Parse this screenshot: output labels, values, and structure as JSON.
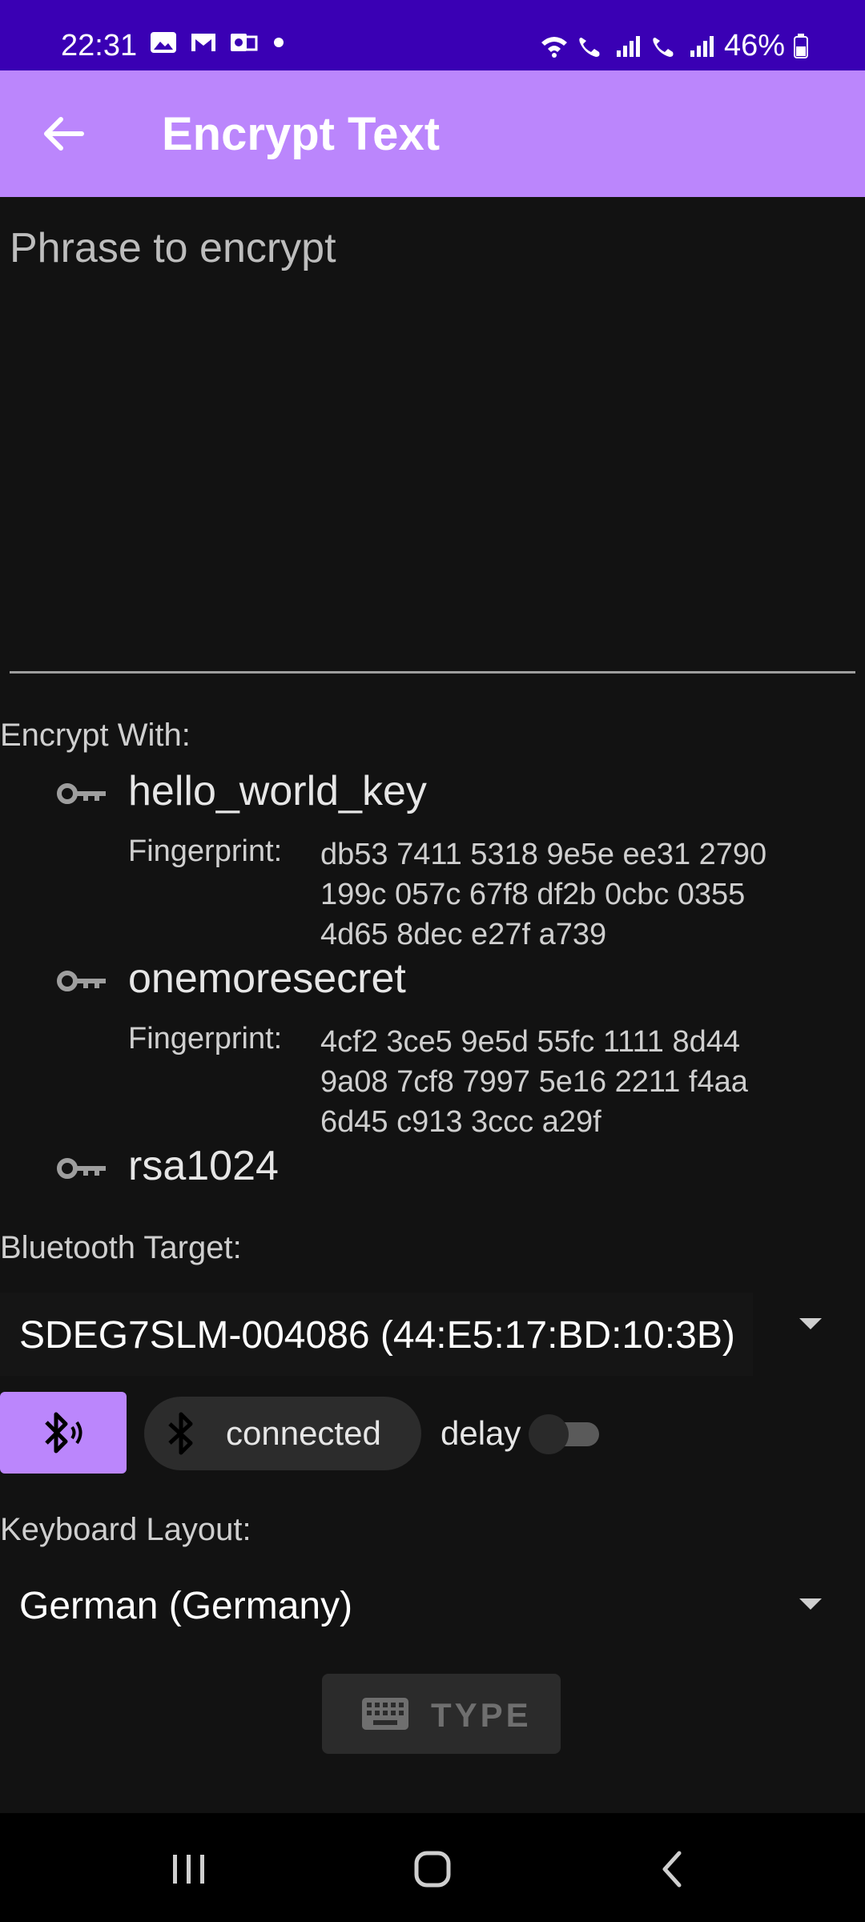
{
  "status_bar": {
    "time": "22:31",
    "battery": "46%",
    "left_icons": [
      "gallery-icon",
      "gmail-icon",
      "outlook-icon",
      "dot"
    ],
    "right_icons": [
      "wifi-icon",
      "wifi-call-1-icon",
      "signal-1-icon",
      "wifi-call-2-icon",
      "signal-2-icon",
      "battery-icon"
    ]
  },
  "app_bar": {
    "title": "Encrypt Text",
    "color": "#bb86fc"
  },
  "phrase": {
    "placeholder": "Phrase to encrypt",
    "value": ""
  },
  "encrypt_with": {
    "label": "Encrypt With:",
    "keys": [
      {
        "name": "hello_world_key",
        "fingerprint_label": "Fingerprint:",
        "fingerprint_lines": [
          "db53 7411 5318 9e5e ee31 2790",
          "199c 057c 67f8 df2b 0cbc 0355",
          "4d65 8dec e27f a739"
        ]
      },
      {
        "name": "onemoresecret",
        "fingerprint_label": "Fingerprint:",
        "fingerprint_lines": [
          "4cf2 3ce5 9e5d 55fc 1111 8d44",
          "9a08 7cf8 7997 5e16 2211 f4aa",
          "6d45 c913 3ccc a29f"
        ]
      },
      {
        "name": "rsa1024",
        "fingerprint_label": "",
        "fingerprint_lines": []
      }
    ]
  },
  "bluetooth": {
    "label": "Bluetooth Target:",
    "selected": "SDEG7SLM-004086 (44:E5:17:BD:10:3B)",
    "status": "connected",
    "delay_label": "delay",
    "delay_on": false
  },
  "keyboard": {
    "label": "Keyboard Layout:",
    "selected": "German (Germany)"
  },
  "type_button": {
    "label": "TYPE"
  }
}
